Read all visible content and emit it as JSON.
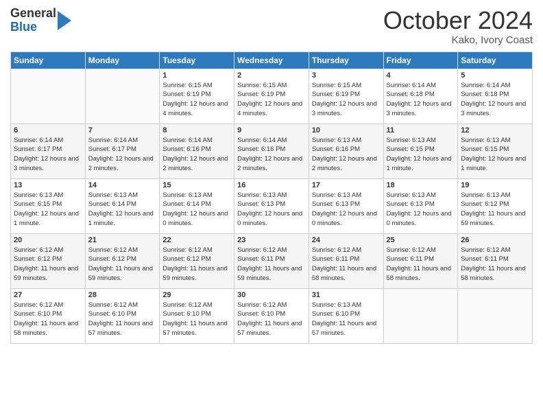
{
  "logo": {
    "general": "General",
    "blue": "Blue"
  },
  "header": {
    "month": "October 2024",
    "location": "Kako, Ivory Coast"
  },
  "days_of_week": [
    "Sunday",
    "Monday",
    "Tuesday",
    "Wednesday",
    "Thursday",
    "Friday",
    "Saturday"
  ],
  "weeks": [
    [
      {
        "day": "",
        "sunrise": "",
        "sunset": "",
        "daylight": ""
      },
      {
        "day": "",
        "sunrise": "",
        "sunset": "",
        "daylight": ""
      },
      {
        "day": "1",
        "sunrise": "Sunrise: 6:15 AM",
        "sunset": "Sunset: 6:19 PM",
        "daylight": "Daylight: 12 hours and 4 minutes."
      },
      {
        "day": "2",
        "sunrise": "Sunrise: 6:15 AM",
        "sunset": "Sunset: 6:19 PM",
        "daylight": "Daylight: 12 hours and 4 minutes."
      },
      {
        "day": "3",
        "sunrise": "Sunrise: 6:15 AM",
        "sunset": "Sunset: 6:19 PM",
        "daylight": "Daylight: 12 hours and 3 minutes."
      },
      {
        "day": "4",
        "sunrise": "Sunrise: 6:14 AM",
        "sunset": "Sunset: 6:18 PM",
        "daylight": "Daylight: 12 hours and 3 minutes."
      },
      {
        "day": "5",
        "sunrise": "Sunrise: 6:14 AM",
        "sunset": "Sunset: 6:18 PM",
        "daylight": "Daylight: 12 hours and 3 minutes."
      }
    ],
    [
      {
        "day": "6",
        "sunrise": "Sunrise: 6:14 AM",
        "sunset": "Sunset: 6:17 PM",
        "daylight": "Daylight: 12 hours and 3 minutes."
      },
      {
        "day": "7",
        "sunrise": "Sunrise: 6:14 AM",
        "sunset": "Sunset: 6:17 PM",
        "daylight": "Daylight: 12 hours and 2 minutes."
      },
      {
        "day": "8",
        "sunrise": "Sunrise: 6:14 AM",
        "sunset": "Sunset: 6:16 PM",
        "daylight": "Daylight: 12 hours and 2 minutes."
      },
      {
        "day": "9",
        "sunrise": "Sunrise: 6:14 AM",
        "sunset": "Sunset: 6:16 PM",
        "daylight": "Daylight: 12 hours and 2 minutes."
      },
      {
        "day": "10",
        "sunrise": "Sunrise: 6:13 AM",
        "sunset": "Sunset: 6:16 PM",
        "daylight": "Daylight: 12 hours and 2 minutes."
      },
      {
        "day": "11",
        "sunrise": "Sunrise: 6:13 AM",
        "sunset": "Sunset: 6:15 PM",
        "daylight": "Daylight: 12 hours and 1 minute."
      },
      {
        "day": "12",
        "sunrise": "Sunrise: 6:13 AM",
        "sunset": "Sunset: 6:15 PM",
        "daylight": "Daylight: 12 hours and 1 minute."
      }
    ],
    [
      {
        "day": "13",
        "sunrise": "Sunrise: 6:13 AM",
        "sunset": "Sunset: 6:15 PM",
        "daylight": "Daylight: 12 hours and 1 minute."
      },
      {
        "day": "14",
        "sunrise": "Sunrise: 6:13 AM",
        "sunset": "Sunset: 6:14 PM",
        "daylight": "Daylight: 12 hours and 1 minute."
      },
      {
        "day": "15",
        "sunrise": "Sunrise: 6:13 AM",
        "sunset": "Sunset: 6:14 PM",
        "daylight": "Daylight: 12 hours and 0 minutes."
      },
      {
        "day": "16",
        "sunrise": "Sunrise: 6:13 AM",
        "sunset": "Sunset: 6:13 PM",
        "daylight": "Daylight: 12 hours and 0 minutes."
      },
      {
        "day": "17",
        "sunrise": "Sunrise: 6:13 AM",
        "sunset": "Sunset: 6:13 PM",
        "daylight": "Daylight: 12 hours and 0 minutes."
      },
      {
        "day": "18",
        "sunrise": "Sunrise: 6:13 AM",
        "sunset": "Sunset: 6:13 PM",
        "daylight": "Daylight: 12 hours and 0 minutes."
      },
      {
        "day": "19",
        "sunrise": "Sunrise: 6:13 AM",
        "sunset": "Sunset: 6:12 PM",
        "daylight": "Daylight: 11 hours and 59 minutes."
      }
    ],
    [
      {
        "day": "20",
        "sunrise": "Sunrise: 6:12 AM",
        "sunset": "Sunset: 6:12 PM",
        "daylight": "Daylight: 11 hours and 59 minutes."
      },
      {
        "day": "21",
        "sunrise": "Sunrise: 6:12 AM",
        "sunset": "Sunset: 6:12 PM",
        "daylight": "Daylight: 11 hours and 59 minutes."
      },
      {
        "day": "22",
        "sunrise": "Sunrise: 6:12 AM",
        "sunset": "Sunset: 6:12 PM",
        "daylight": "Daylight: 11 hours and 59 minutes."
      },
      {
        "day": "23",
        "sunrise": "Sunrise: 6:12 AM",
        "sunset": "Sunset: 6:11 PM",
        "daylight": "Daylight: 11 hours and 59 minutes."
      },
      {
        "day": "24",
        "sunrise": "Sunrise: 6:12 AM",
        "sunset": "Sunset: 6:11 PM",
        "daylight": "Daylight: 11 hours and 58 minutes."
      },
      {
        "day": "25",
        "sunrise": "Sunrise: 6:12 AM",
        "sunset": "Sunset: 6:11 PM",
        "daylight": "Daylight: 11 hours and 58 minutes."
      },
      {
        "day": "26",
        "sunrise": "Sunrise: 6:12 AM",
        "sunset": "Sunset: 6:11 PM",
        "daylight": "Daylight: 11 hours and 58 minutes."
      }
    ],
    [
      {
        "day": "27",
        "sunrise": "Sunrise: 6:12 AM",
        "sunset": "Sunset: 6:10 PM",
        "daylight": "Daylight: 11 hours and 58 minutes."
      },
      {
        "day": "28",
        "sunrise": "Sunrise: 6:12 AM",
        "sunset": "Sunset: 6:10 PM",
        "daylight": "Daylight: 11 hours and 57 minutes."
      },
      {
        "day": "29",
        "sunrise": "Sunrise: 6:12 AM",
        "sunset": "Sunset: 6:10 PM",
        "daylight": "Daylight: 11 hours and 57 minutes."
      },
      {
        "day": "30",
        "sunrise": "Sunrise: 6:12 AM",
        "sunset": "Sunset: 6:10 PM",
        "daylight": "Daylight: 11 hours and 57 minutes."
      },
      {
        "day": "31",
        "sunrise": "Sunrise: 6:13 AM",
        "sunset": "Sunset: 6:10 PM",
        "daylight": "Daylight: 11 hours and 57 minutes."
      },
      {
        "day": "",
        "sunrise": "",
        "sunset": "",
        "daylight": ""
      },
      {
        "day": "",
        "sunrise": "",
        "sunset": "",
        "daylight": ""
      }
    ]
  ]
}
